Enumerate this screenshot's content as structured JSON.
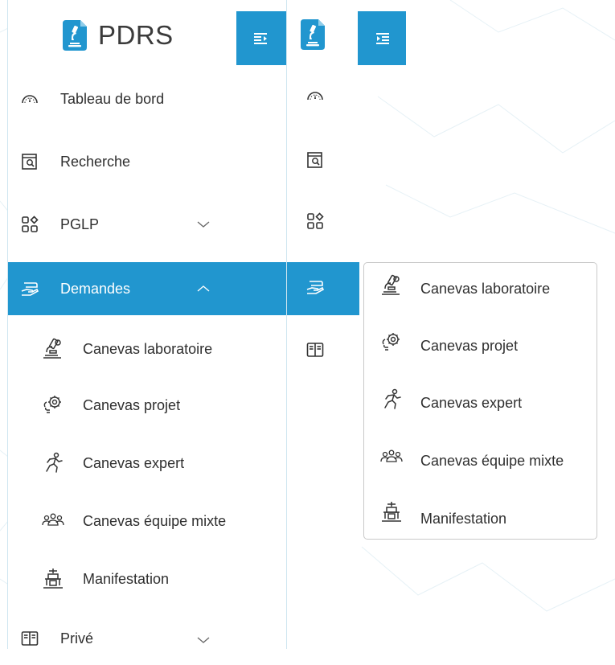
{
  "brand": {
    "name": "PDRS"
  },
  "colors": {
    "accent": "#2196cf",
    "text": "#2f2f2f"
  },
  "sidebar": {
    "items": [
      {
        "label": "Tableau de bord",
        "icon": "dashboard-gauge-icon"
      },
      {
        "label": "Recherche",
        "icon": "search-document-icon"
      },
      {
        "label": "PGLP",
        "icon": "grid-apps-icon",
        "expandable": true,
        "expanded": false
      },
      {
        "label": "Demandes",
        "icon": "hand-tray-icon",
        "expandable": true,
        "expanded": true,
        "active": true
      },
      {
        "label": "Privé",
        "icon": "book-icon",
        "expandable": true,
        "expanded": false
      }
    ],
    "demandes_sub": [
      {
        "label": "Canevas laboratoire",
        "icon": "microscope-icon"
      },
      {
        "label": "Canevas projet",
        "icon": "gear-bulb-icon"
      },
      {
        "label": "Canevas expert",
        "icon": "running-person-icon"
      },
      {
        "label": "Canevas équipe mixte",
        "icon": "team-icon"
      },
      {
        "label": "Manifestation",
        "icon": "podium-icon"
      }
    ]
  },
  "flyout": {
    "items": [
      {
        "label": "Canevas laboratoire"
      },
      {
        "label": "Canevas projet"
      },
      {
        "label": "Canevas expert"
      },
      {
        "label": "Canevas équipe mixte"
      },
      {
        "label": "Manifestation"
      }
    ]
  }
}
